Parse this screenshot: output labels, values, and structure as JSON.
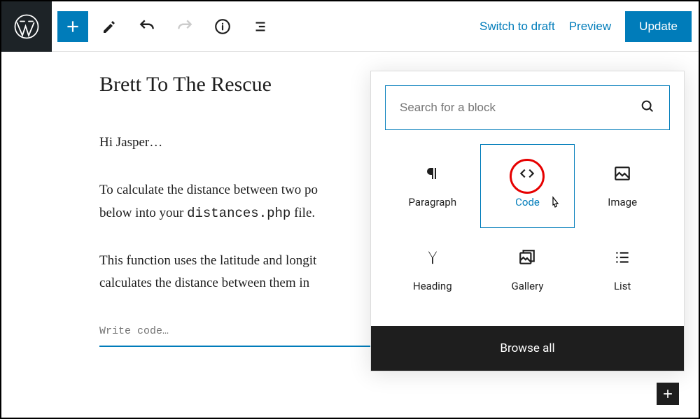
{
  "toolbar": {
    "switch_draft": "Switch to draft",
    "preview": "Preview",
    "update": "Update"
  },
  "post": {
    "title": "Brett To The Rescue",
    "p1": "Hi Jasper…",
    "p2_a": "To calculate the distance between two po",
    "p2_b": "below into your ",
    "p2_code": "distances.php",
    "p2_c": " file.",
    "p3_a": "This function uses the latitude and longit",
    "p3_b": "calculates the distance between them in",
    "code_placeholder": "Write code…"
  },
  "inserter": {
    "search_placeholder": "Search for a block",
    "blocks": {
      "paragraph": "Paragraph",
      "code": "Code",
      "image": "Image",
      "heading": "Heading",
      "gallery": "Gallery",
      "list": "List"
    },
    "browse_all": "Browse all"
  }
}
